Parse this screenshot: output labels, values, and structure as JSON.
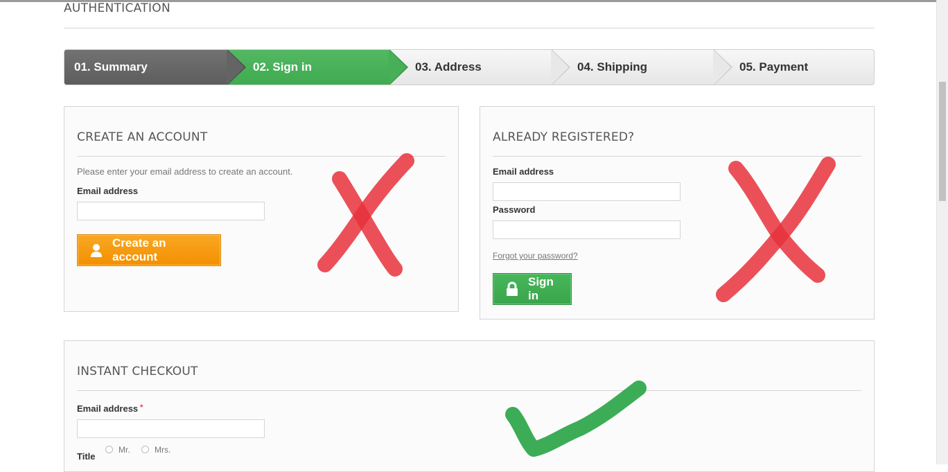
{
  "page": {
    "heading": "AUTHENTICATION"
  },
  "steps": [
    {
      "label": "01. Summary",
      "state": "done"
    },
    {
      "label": "02. Sign in",
      "state": "current"
    },
    {
      "label": "03. Address",
      "state": "todo"
    },
    {
      "label": "04. Shipping",
      "state": "todo"
    },
    {
      "label": "05. Payment",
      "state": "todo"
    }
  ],
  "create_account": {
    "title": "CREATE AN ACCOUNT",
    "hint": "Please enter your email address to create an account.",
    "email_label": "Email address",
    "email_value": "",
    "button_label": "Create an account",
    "button_icon": "user-icon",
    "button_color": "#f49a0e"
  },
  "already_registered": {
    "title": "ALREADY REGISTERED?",
    "email_label": "Email address",
    "email_value": "",
    "password_label": "Password",
    "password_value": "",
    "forgot_label": "Forgot your password?",
    "button_label": "Sign in",
    "button_icon": "lock-icon",
    "button_color": "#3fab50"
  },
  "instant_checkout": {
    "title": "INSTANT CHECKOUT",
    "email_label": "Email address",
    "required_marker": "*",
    "email_value": "",
    "title_label": "Title",
    "title_options": [
      "Mr.",
      "Mrs."
    ]
  },
  "annotations": {
    "cross_color": "#e8313c",
    "check_color": "#27a444"
  }
}
